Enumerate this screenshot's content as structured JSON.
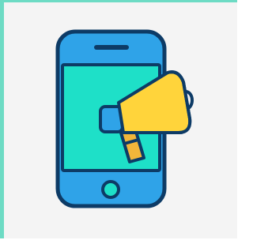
{
  "illustration": {
    "icon": "mobile-marketing-megaphone-icon",
    "colors": {
      "background": "#f4f4f4",
      "frame_accent": "#6ddbc4",
      "outline": "#0d3b66",
      "phone_body": "#2fa3e8",
      "screen": "#1ee0c8",
      "megaphone_bell": "#ffd43b",
      "megaphone_handle": "#f2b63a",
      "megaphone_back": "#2fa3e8"
    }
  }
}
